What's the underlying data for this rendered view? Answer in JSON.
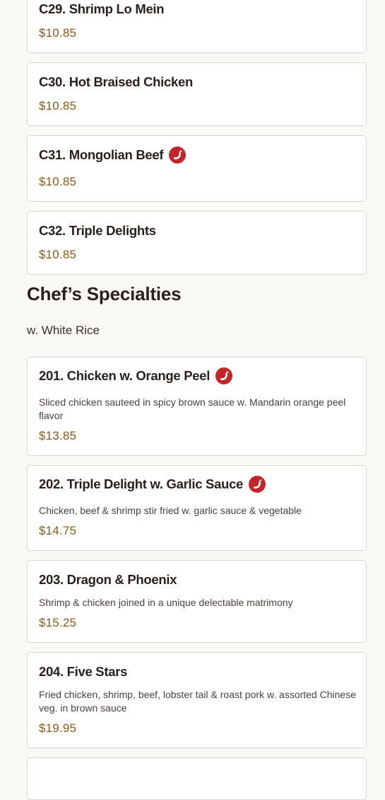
{
  "colors": {
    "background": "#faf8f5",
    "card_background": "#ffffff",
    "card_border": "#d9d4cf",
    "item_name": "#2a1f1a",
    "price": "#8a5a1a",
    "spicy_icon": "#c0262a"
  },
  "items_before": [
    {
      "name": "C29. Shrimp Lo Mein",
      "price": "$10.85",
      "spicy": false
    },
    {
      "name": "C30. Hot Braised Chicken",
      "price": "$10.85",
      "spicy": false
    },
    {
      "name": "C31. Mongolian Beef",
      "price": "$10.85",
      "spicy": true,
      "icon": "chili-pepper-icon"
    },
    {
      "name": "C32. Triple Delights",
      "price": "$10.85",
      "spicy": false
    }
  ],
  "section": {
    "title": "Chef’s Specialties",
    "subtitle": "w. White Rice"
  },
  "items": [
    {
      "name": "201. Chicken w. Orange Peel",
      "description": "Sliced chicken sauteed in spicy brown sauce w. Mandarin orange peel flavor",
      "price": "$13.85",
      "spicy": true,
      "icon": "chili-pepper-icon"
    },
    {
      "name": "202. Triple Delight w. Garlic Sauce",
      "description": "Chicken, beef & shrimp stir fried w. garlic sauce & vegetable",
      "price": "$14.75",
      "spicy": true,
      "icon": "chili-pepper-icon"
    },
    {
      "name": "203. Dragon & Phoenix",
      "description": "Shrimp & chicken joined in a unique delectable matrimony",
      "price": "$15.25",
      "spicy": false
    },
    {
      "name": "204. Five Stars",
      "description": "Fried chicken, shrimp, beef, lobster tail & roast pork w. assorted Chinese veg. in brown sauce",
      "price": "$19.95",
      "spicy": false
    }
  ]
}
